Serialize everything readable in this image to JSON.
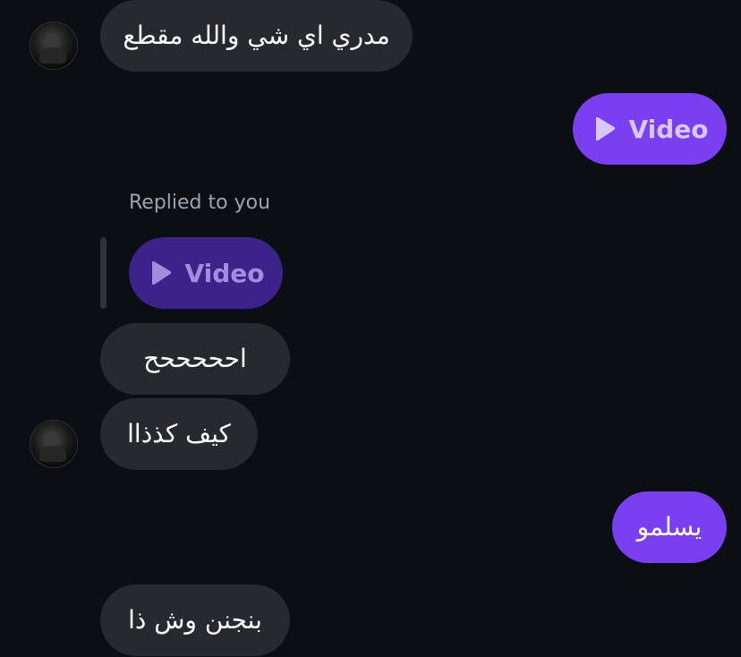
{
  "messages": [
    {
      "text": "مدري اي شي والله مقطع"
    },
    {
      "video_label": "Video"
    },
    {
      "reply_label": "Replied to you",
      "video_label": "Video"
    },
    {
      "text": "احححححح"
    },
    {
      "text": "كيف كذذاا"
    },
    {
      "text": "يسلمو"
    },
    {
      "text": "بنجنن وش ذا"
    }
  ],
  "colors": {
    "background": "#0b0f14",
    "incoming_bubble": "#262a2f",
    "outgoing_bubble": "#7b3ff2",
    "reply_video_bubble": "#3d2389"
  },
  "icons": {
    "video": "play-icon",
    "avatar": "contact-avatar"
  }
}
